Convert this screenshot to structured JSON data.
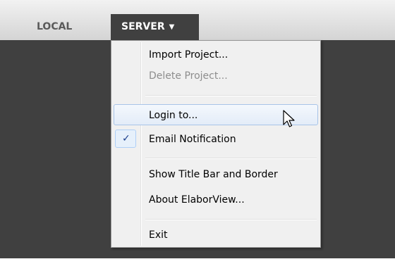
{
  "menubar": {
    "items": [
      {
        "label": "LOCAL"
      },
      {
        "label": "SERVER",
        "caret": "▼"
      }
    ]
  },
  "menu": {
    "items": [
      {
        "label": "Import Project...",
        "state": "enabled"
      },
      {
        "label": "Delete Project...",
        "state": "disabled"
      },
      {
        "label": "Login to...",
        "state": "hover"
      },
      {
        "label": "Email Notification",
        "state": "checked",
        "check": "✓"
      },
      {
        "label": "Show Title Bar and Border",
        "state": "enabled"
      },
      {
        "label": "About ElaborView...",
        "state": "enabled"
      },
      {
        "label": "Exit",
        "state": "enabled"
      }
    ]
  },
  "colors": {
    "workspace": "#404040",
    "menu_bg": "#f0f0f0",
    "hover_border": "#a8c4e8",
    "check": "#1a3e8c"
  },
  "cursor": {
    "icon": "arrow-pointer-icon"
  }
}
